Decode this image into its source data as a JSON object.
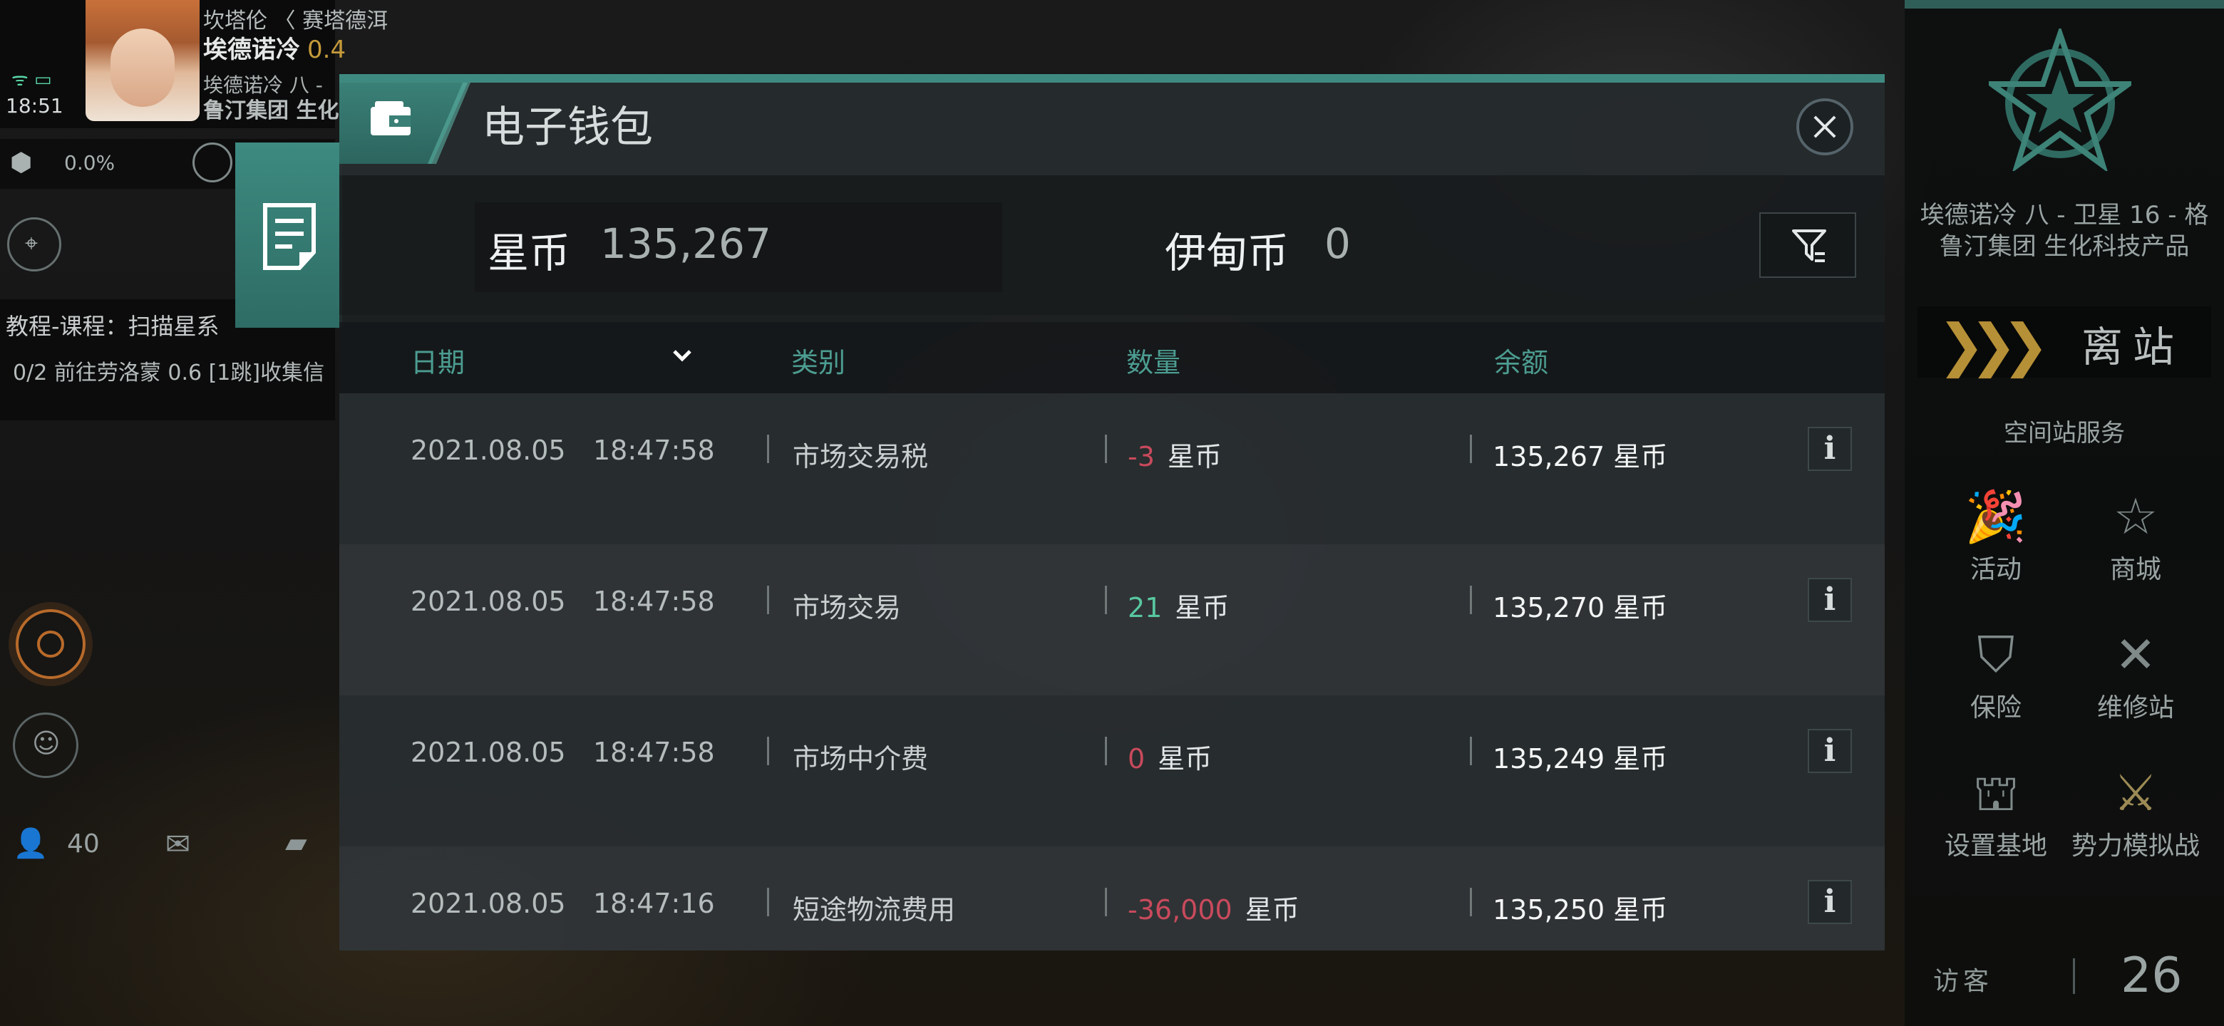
{
  "hud": {
    "location_path": "坎塔伦 〈 赛塔德洱",
    "system_name": "埃德诺冷",
    "security": "0.4",
    "station_line1": "埃德诺冷 八 -",
    "station_line2": "鲁汀集团 生化",
    "clock": "18:51",
    "cargo_percent": "0.0%",
    "tutorial_title": "教程-课程：扫描星系",
    "tutorial_task": "0/2  前往劳洛蒙 0.6 [1跳]收集信",
    "people_count": "40"
  },
  "wallet": {
    "title": "电子钱包",
    "currency1_label": "星币",
    "currency1_value": "135,267",
    "currency2_label": "伊甸币",
    "currency2_value": "0",
    "columns": {
      "date": "日期",
      "category": "类别",
      "amount": "数量",
      "balance": "余额"
    },
    "rows": [
      {
        "date": "2021.08.05",
        "time": "18:47:58",
        "category": "市场交易税",
        "amount": "-3",
        "unit": "星币",
        "balance": "135,267 星币",
        "sign": "neg"
      },
      {
        "date": "2021.08.05",
        "time": "18:47:58",
        "category": "市场交易",
        "amount": "21",
        "unit": "星币",
        "balance": "135,270 星币",
        "sign": "pos"
      },
      {
        "date": "2021.08.05",
        "time": "18:47:58",
        "category": "市场中介费",
        "amount": "0",
        "unit": "星币",
        "balance": "135,249 星币",
        "sign": "neg"
      },
      {
        "date": "2021.08.05",
        "time": "18:47:16",
        "category": "短途物流费用",
        "amount": "-36,000",
        "unit": "星币",
        "balance": "135,250 星币",
        "sign": "neg"
      }
    ]
  },
  "right": {
    "station_name": "埃德诺冷 八 - 卫星 16 - 格鲁汀集团 生化科技产品",
    "undock": "离站",
    "services_title": "空间站服务",
    "services": [
      "活动",
      "商城",
      "保险",
      "维修站",
      "设置基地",
      "势力模拟战"
    ],
    "visitor_label": "访客",
    "visitor_count": "26"
  },
  "colors": {
    "accent": "#3f8a80",
    "negative": "#c84a5c",
    "positive": "#58c7a0",
    "header_text": "#4c9d91",
    "undock_chevron": "#b69036"
  }
}
